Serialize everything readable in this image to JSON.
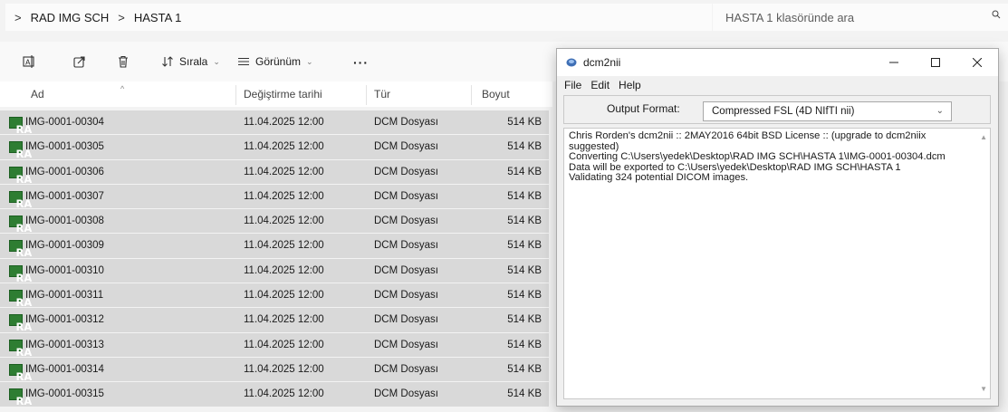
{
  "explorer": {
    "breadcrumb": [
      "RAD IMG SCH",
      "HASTA 1"
    ],
    "search_placeholder": "HASTA 1 klasöründe ara",
    "toolbar": {
      "sort_label": "Sırala",
      "view_label": "Görünüm",
      "more_label": "···"
    },
    "columns": {
      "name": "Ad",
      "modified": "Değiştirme tarihi",
      "type": "Tür",
      "size": "Boyut"
    },
    "file_icon_text": "RA",
    "files": [
      {
        "name": "IMG-0001-00304",
        "modified": "11.04.2025 12:00",
        "type": "DCM Dosyası",
        "size": "514 KB"
      },
      {
        "name": "IMG-0001-00305",
        "modified": "11.04.2025 12:00",
        "type": "DCM Dosyası",
        "size": "514 KB"
      },
      {
        "name": "IMG-0001-00306",
        "modified": "11.04.2025 12:00",
        "type": "DCM Dosyası",
        "size": "514 KB"
      },
      {
        "name": "IMG-0001-00307",
        "modified": "11.04.2025 12:00",
        "type": "DCM Dosyası",
        "size": "514 KB"
      },
      {
        "name": "IMG-0001-00308",
        "modified": "11.04.2025 12:00",
        "type": "DCM Dosyası",
        "size": "514 KB"
      },
      {
        "name": "IMG-0001-00309",
        "modified": "11.04.2025 12:00",
        "type": "DCM Dosyası",
        "size": "514 KB"
      },
      {
        "name": "IMG-0001-00310",
        "modified": "11.04.2025 12:00",
        "type": "DCM Dosyası",
        "size": "514 KB"
      },
      {
        "name": "IMG-0001-00311",
        "modified": "11.04.2025 12:00",
        "type": "DCM Dosyası",
        "size": "514 KB"
      },
      {
        "name": "IMG-0001-00312",
        "modified": "11.04.2025 12:00",
        "type": "DCM Dosyası",
        "size": "514 KB"
      },
      {
        "name": "IMG-0001-00313",
        "modified": "11.04.2025 12:00",
        "type": "DCM Dosyası",
        "size": "514 KB"
      },
      {
        "name": "IMG-0001-00314",
        "modified": "11.04.2025 12:00",
        "type": "DCM Dosyası",
        "size": "514 KB"
      },
      {
        "name": "IMG-0001-00315",
        "modified": "11.04.2025 12:00",
        "type": "DCM Dosyası",
        "size": "514 KB"
      }
    ]
  },
  "dcm2nii": {
    "title": "dcm2nii",
    "menus": [
      "File",
      "Edit",
      "Help"
    ],
    "output_format_label": "Output Format:",
    "output_format_value": "Compressed FSL (4D NIfTI nii)",
    "log_lines": [
      "Chris Rorden's dcm2nii :: 2MAY2016 64bit BSD License  :: (upgrade to dcm2niix suggested)",
      "Converting C:\\Users\\yedek\\Desktop\\RAD IMG SCH\\HASTA 1\\IMG-0001-00304.dcm",
      "Data will be exported to C:\\Users\\yedek\\Desktop\\RAD IMG SCH\\HASTA 1",
      "Validating 324 potential DICOM images."
    ]
  },
  "colors": {
    "row_selected": "#d9d9d9",
    "file_icon_green": "#2e7d32",
    "window_bg": "#f0f0f0"
  }
}
